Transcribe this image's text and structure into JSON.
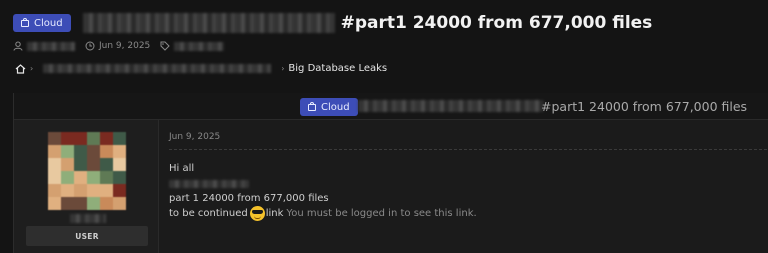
{
  "header": {
    "category_badge": "Cloud",
    "title_suffix": "#part1 24000 from 677,000 files",
    "meta": {
      "date": "Jun 9, 2025"
    }
  },
  "breadcrumb": {
    "current": "Big Database Leaks"
  },
  "thread_header": {
    "category_badge": "Cloud",
    "title_suffix": "#part1 24000 from 677,000 files"
  },
  "author": {
    "role": "USER"
  },
  "post": {
    "date": "Jun 9, 2025",
    "greeting": "Hi all",
    "line2": "part 1 24000 from 677,000 files",
    "line3_prefix": "to be continued",
    "link_word": "link",
    "login_note": "You must be logged in to see this link."
  },
  "colors": {
    "badge_bg": "#3d4db7",
    "page_bg": "#141414"
  }
}
